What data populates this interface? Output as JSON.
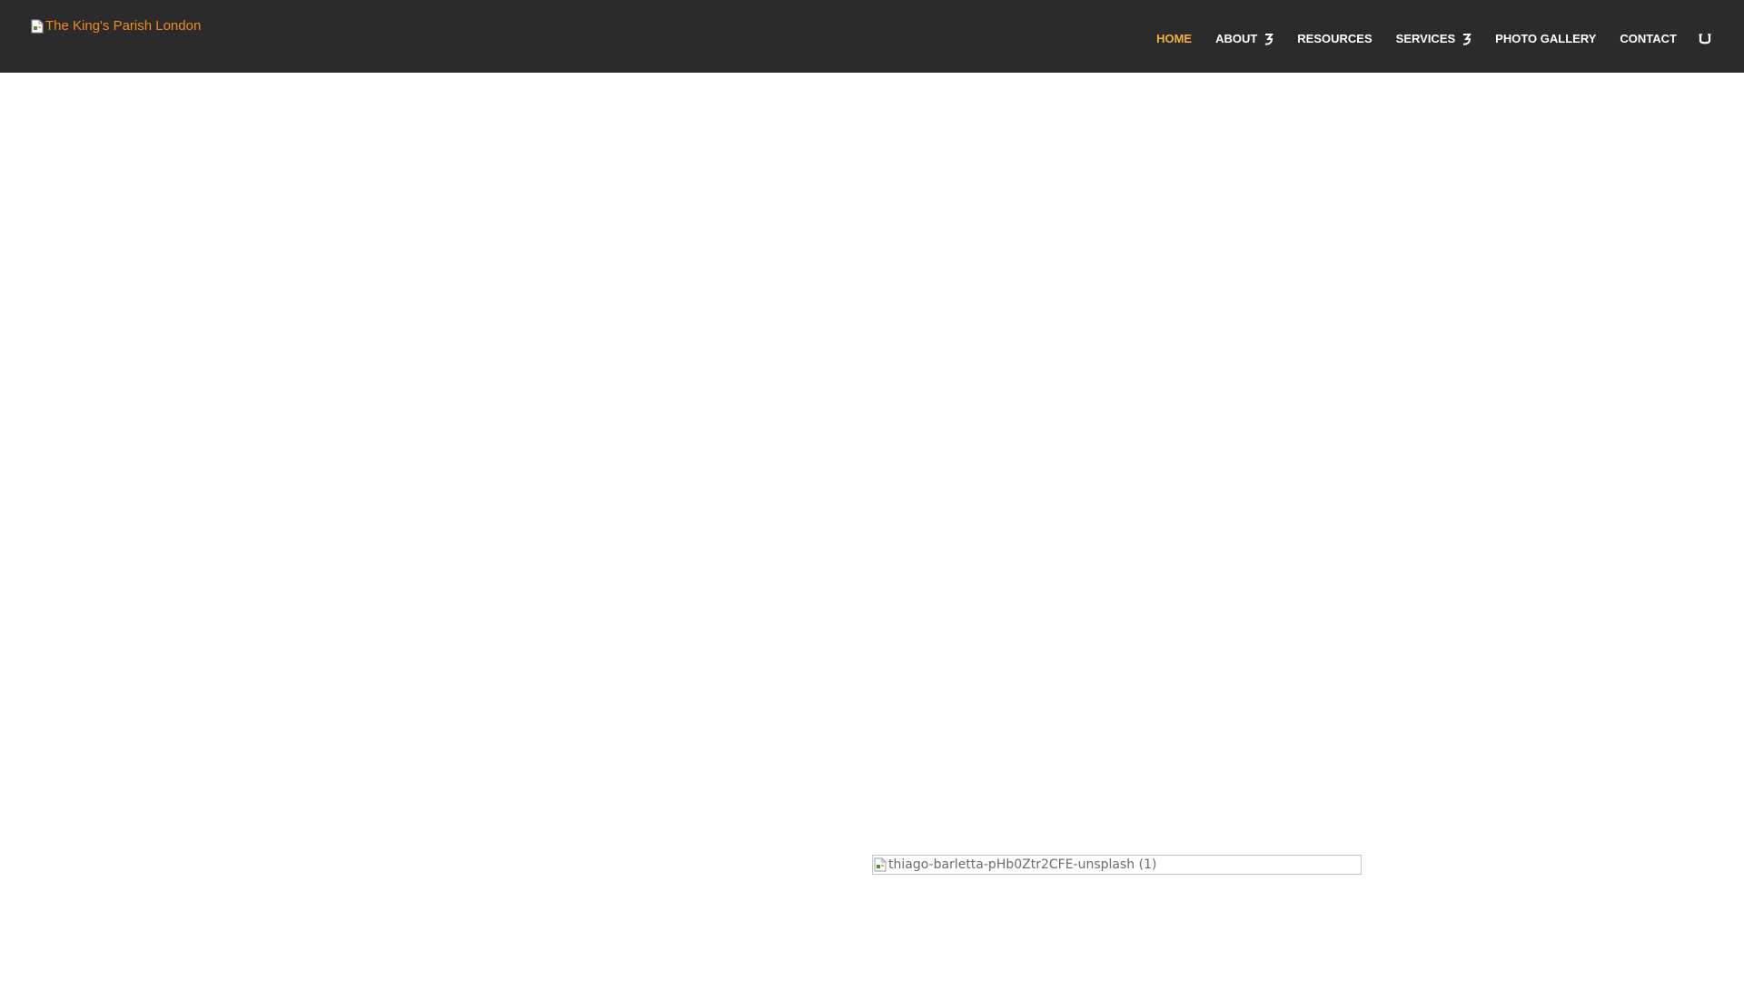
{
  "header": {
    "logo_alt": "The King's Parish London",
    "nav": [
      {
        "label": "HOME",
        "active": true,
        "has_submenu": false
      },
      {
        "label": "ABOUT",
        "active": false,
        "has_submenu": true
      },
      {
        "label": "RESOURCES",
        "active": false,
        "has_submenu": false
      },
      {
        "label": "SERVICES",
        "active": false,
        "has_submenu": true
      },
      {
        "label": "PHOTO GALLERY",
        "active": false,
        "has_submenu": false
      },
      {
        "label": "CONTACT",
        "active": false,
        "has_submenu": false
      }
    ],
    "menu_icon": "hamburger-icon"
  },
  "main": {
    "image_alt": "thiago-barletta-pHb0Ztr2CFE-unsplash (1)"
  },
  "colors": {
    "header_bg": "#2b2b2b",
    "accent": "#f0b03c",
    "logo_text": "#f08a1c",
    "nav_text": "#ffffff"
  }
}
